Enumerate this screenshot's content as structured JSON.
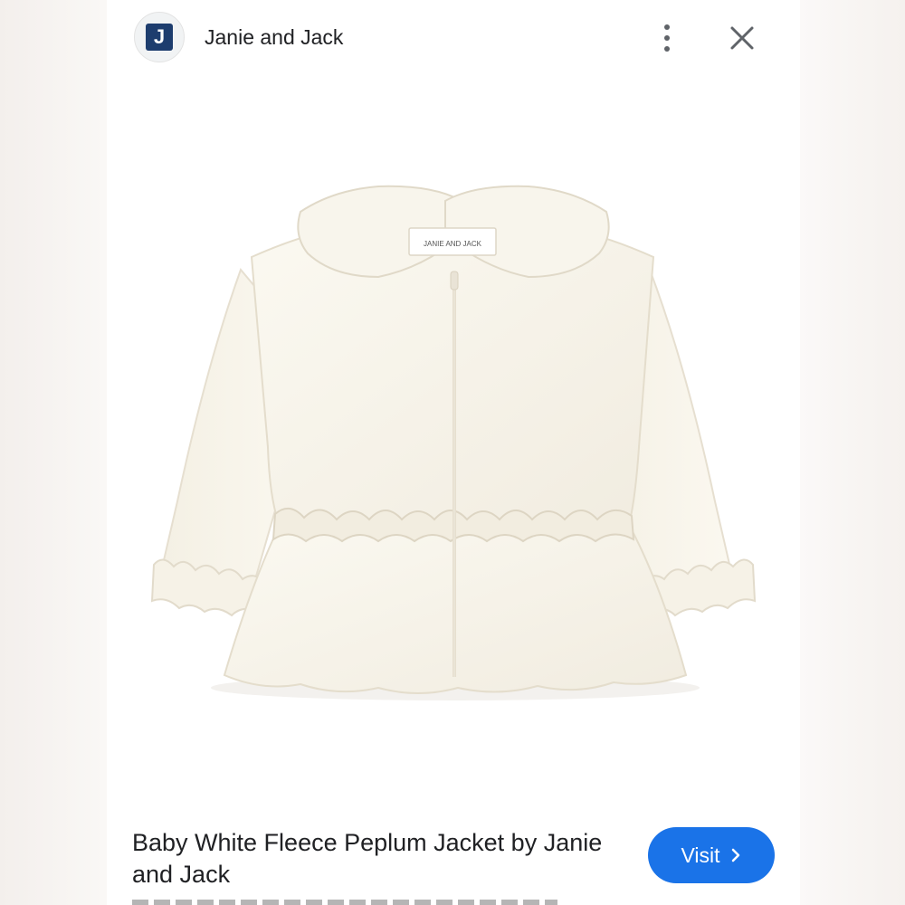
{
  "source": {
    "logo_letter": "J",
    "name": "Janie and Jack"
  },
  "header": {
    "more_icon": "more-vert-icon",
    "close_icon": "close-icon"
  },
  "image": {
    "label_text": "JANIE AND JACK"
  },
  "product": {
    "title": "Baby White Fleece Peplum Jacket by Janie and Jack"
  },
  "visit_button": {
    "label": "Visit",
    "icon": "chevron-right-icon",
    "color": "#1a73e8"
  }
}
